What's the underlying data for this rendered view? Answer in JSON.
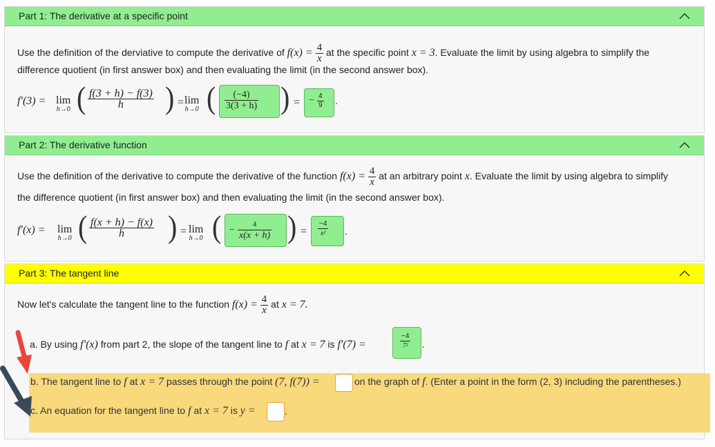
{
  "part1": {
    "title": "Part 1: The derivative at a specific point",
    "intro_a": "Use the definition of the derviative to compute the derivative of",
    "func_lhs": "f(x) =",
    "func_num": "4",
    "func_den": "x",
    "intro_b": "at the specific point",
    "point": "x = 3",
    "intro_c": ". Evaluate the limit by using algebra to simplify the",
    "intro_line2": "difference quotient (in first answer box) and then evaluating the limit (in the second answer box).",
    "lhs": "f′(3) =",
    "lim": "lim",
    "lim_sub": "h→0",
    "dq_num": "f(3 + h) − f(3)",
    "dq_den": "h",
    "eq": "=",
    "ans1_num": "(−4)",
    "ans1_den": "3(3 + h)",
    "ans2_sign": "−",
    "ans2_num": "4",
    "ans2_den": "9",
    "period": "."
  },
  "part2": {
    "title": "Part 2: The derivative function",
    "intro_a": "Use the definition of the derivative to compute the derivative of the function",
    "func_lhs": "f(x) =",
    "func_num": "4",
    "func_den": "x",
    "intro_b": "at an arbitrary point",
    "var": "x",
    "intro_c": ". Evaluate the limit by using algebra to simplify",
    "intro_line2": "the difference quotient (in first answer box) and then evaluating the limit (in the second answer box).",
    "lhs": "f′(x) =",
    "lim": "lim",
    "lim_sub": "h→0",
    "dq_num": "f(x + h) − f(x)",
    "dq_den": "h",
    "eq": "=",
    "ans1_sign": "−",
    "ans1_num": "4",
    "ans1_den": "x(x + h)",
    "ans2_num": "−4",
    "ans2_den": "x²",
    "period": "."
  },
  "part3": {
    "title": "Part 3: The tangent line",
    "intro_a": "Now let's calculate the tangent line to the function",
    "func_lhs": "f(x) =",
    "func_num": "4",
    "func_den": "x",
    "intro_b": "at",
    "point": "x = 7.",
    "a_text1": "a. By using",
    "a_fprime": "f′(x)",
    "a_text2": "from part 2, the slope of the tangent line to",
    "a_f": "f",
    "a_text3": "at",
    "a_point": "x = 7",
    "a_text4": "is",
    "a_lhs": "f′(7) =",
    "a_ans_num": "−4",
    "a_ans_den": "7²",
    "period": ".",
    "b_text1": "b. The tangent line to",
    "b_f": "f",
    "b_text2": "at",
    "b_point": "x = 7",
    "b_text3": "passes through the point",
    "b_pt": "(7, f(7)) =",
    "b_text4": "on the graph of",
    "b_f2": "f",
    "b_text5": ". (Enter a point in the form (2, 3) including the parentheses.)",
    "c_text1": "c. An equation for the tangent line to",
    "c_f": "f",
    "c_text2": "at",
    "c_point": "x = 7",
    "c_text3": "is",
    "c_lhs": "y ="
  },
  "colors": {
    "correct": "#90ee90",
    "active": "#ffff00",
    "highlight": "#f7d56e",
    "arrow_red": "#e8463a",
    "arrow_dark": "#3b4a57"
  },
  "icons": [
    "chevron-up-icon",
    "red-arrow-icon",
    "dark-arrow-icon"
  ]
}
